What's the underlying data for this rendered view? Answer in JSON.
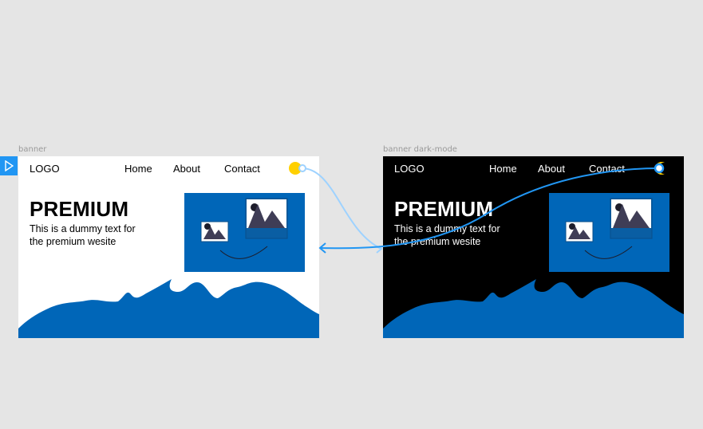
{
  "canvas": {
    "frames": [
      {
        "name": "banner",
        "mode": "light",
        "logo": "LOGO",
        "nav": [
          "Home",
          "About",
          "Contact"
        ],
        "headline": "PREMIUM",
        "body_line1": "This is a dummy text for",
        "body_line2": "the premium wesite",
        "toggle_icon": "sun-icon"
      },
      {
        "name": "banner dark-mode",
        "mode": "dark",
        "logo": "LOGO",
        "nav": [
          "Home",
          "About",
          "Contact"
        ],
        "headline": "PREMIUM",
        "body_line1": "This is a dummy text for",
        "body_line2": "the premium wesite",
        "toggle_icon": "moon-icon"
      }
    ],
    "colors": {
      "canvas_bg": "#e5e5e5",
      "brand_blue": "#0066b8",
      "sun_yellow": "#ffd000",
      "prototype_arrow": "#2196f3",
      "prototype_arrow_light": "#9ed2ff"
    }
  }
}
